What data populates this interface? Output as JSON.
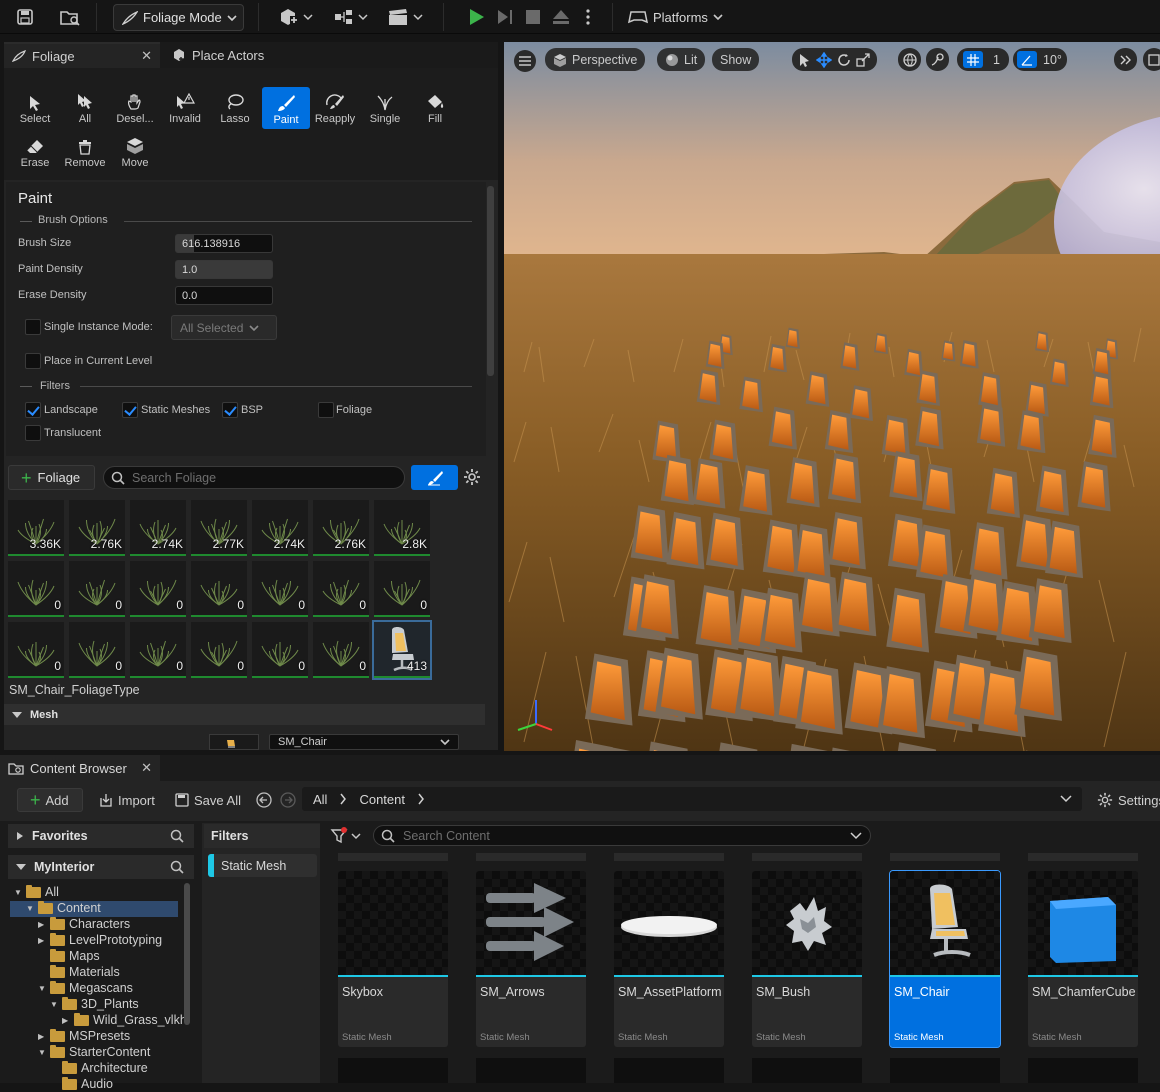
{
  "toolbar": {
    "mode_label": "Foliage Mode",
    "platforms_label": "Platforms"
  },
  "foliage_panel": {
    "tab_foliage": "Foliage",
    "tab_place_actors": "Place Actors",
    "tools": [
      {
        "label": "Select"
      },
      {
        "label": "All"
      },
      {
        "label": "Desel..."
      },
      {
        "label": "Invalid"
      },
      {
        "label": "Lasso"
      },
      {
        "label": "Paint"
      },
      {
        "label": "Reapply"
      },
      {
        "label": "Single"
      },
      {
        "label": "Fill"
      },
      {
        "label": "Erase"
      },
      {
        "label": "Remove"
      },
      {
        "label": "Move"
      }
    ],
    "section_title": "Paint",
    "brush_options_label": "Brush Options",
    "brush_size_label": "Brush Size",
    "brush_size_value": "616.138916",
    "paint_density_label": "Paint Density",
    "paint_density_value": "1.0",
    "erase_density_label": "Erase Density",
    "erase_density_value": "0.0",
    "single_instance_label": "Single Instance Mode:",
    "single_instance_value": "All Selected",
    "place_in_level_label": "Place in Current Level",
    "filters_label": "Filters",
    "filters": {
      "landscape": "Landscape",
      "static_meshes": "Static Meshes",
      "bsp": "BSP",
      "foliage": "Foliage",
      "translucent": "Translucent"
    },
    "add_foliage_label": "Foliage",
    "search_placeholder": "Search Foliage",
    "foliage_counts": [
      "3.36K",
      "2.76K",
      "2.74K",
      "2.77K",
      "2.74K",
      "2.76K",
      "2.8K",
      "0",
      "0",
      "0",
      "0",
      "0",
      "0",
      "0",
      "0",
      "0",
      "0",
      "0",
      "0",
      "0",
      "413"
    ],
    "selected_type_label": "SM_Chair_FoliageType",
    "mesh_section_label": "Mesh",
    "mesh_value": "SM_Chair"
  },
  "viewport": {
    "perspective_label": "Perspective",
    "lit_label": "Lit",
    "show_label": "Show",
    "grid_value": "1",
    "angle_value": "10°"
  },
  "content_browser": {
    "tab_label": "Content Browser",
    "add_label": "Add",
    "import_label": "Import",
    "save_all_label": "Save All",
    "path": [
      "All",
      "Content"
    ],
    "settings_label": "Settings",
    "favorites_label": "Favorites",
    "project_label": "MyInterior",
    "filters_label": "Filters",
    "filter_chip": "Static Mesh",
    "search_placeholder": "Search Content",
    "tree": [
      {
        "label": "All"
      },
      {
        "label": "Content"
      },
      {
        "label": "Characters"
      },
      {
        "label": "LevelPrototyping"
      },
      {
        "label": "Maps"
      },
      {
        "label": "Materials"
      },
      {
        "label": "Megascans"
      },
      {
        "label": "3D_Plants"
      },
      {
        "label": "Wild_Grass_vlkh"
      },
      {
        "label": "MSPresets"
      },
      {
        "label": "StarterContent"
      },
      {
        "label": "Architecture"
      },
      {
        "label": "Audio"
      }
    ],
    "assets": [
      {
        "name": "Skybox",
        "type": "Static Mesh"
      },
      {
        "name": "SM_Arrows",
        "type": "Static Mesh"
      },
      {
        "name": "SM_AssetPlatform",
        "type": "Static Mesh"
      },
      {
        "name": "SM_Bush",
        "type": "Static Mesh"
      },
      {
        "name": "SM_Chair",
        "type": "Static Mesh"
      },
      {
        "name": "SM_ChamferCube",
        "type": "Static Mesh"
      }
    ]
  },
  "colors": {
    "accent": "#0070e0",
    "play_green": "#3cb44b",
    "asset_bar": "#1ec8e6"
  }
}
